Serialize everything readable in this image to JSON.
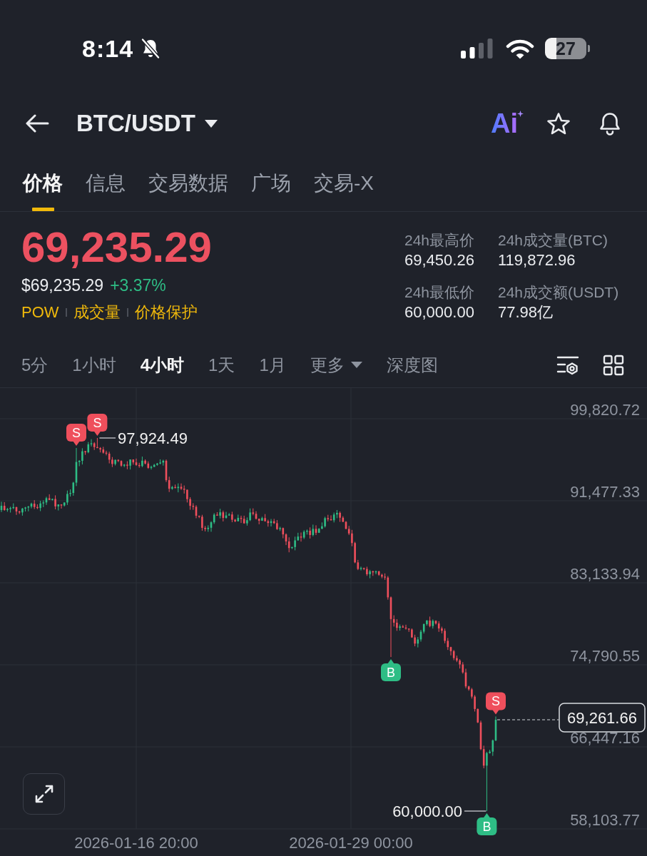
{
  "status_bar": {
    "time": "8:14",
    "battery": "27"
  },
  "header": {
    "pair": "BTC/USDT",
    "ai_label": "Ai"
  },
  "tabs": [
    {
      "label": "价格",
      "selected": true
    },
    {
      "label": "信息",
      "selected": false
    },
    {
      "label": "交易数据",
      "selected": false
    },
    {
      "label": "广场",
      "selected": false
    },
    {
      "label": "交易-X",
      "selected": false
    }
  ],
  "price": {
    "last": "69,235.29",
    "fiat": "$69,235.29",
    "change": "+3.37%",
    "tags": [
      "POW",
      "成交量",
      "价格保护"
    ]
  },
  "stats": [
    {
      "label": "24h最高价",
      "value": "69,450.26"
    },
    {
      "label": "24h成交量(BTC)",
      "value": "119,872.96"
    },
    {
      "label": "24h最低价",
      "value": "60,000.00"
    },
    {
      "label": "24h成交额(USDT)",
      "value": "77.98亿"
    }
  ],
  "intervals": [
    {
      "label": "5分",
      "selected": false,
      "kind": "option"
    },
    {
      "label": "1小时",
      "selected": false,
      "kind": "option"
    },
    {
      "label": "4小时",
      "selected": true,
      "kind": "option"
    },
    {
      "label": "1天",
      "selected": false,
      "kind": "option"
    },
    {
      "label": "1月",
      "selected": false,
      "kind": "option"
    },
    {
      "label": "更多",
      "selected": false,
      "kind": "menu"
    },
    {
      "label": "深度图",
      "selected": false,
      "kind": "option"
    }
  ],
  "chart": {
    "y_axis_labels": [
      "99,820.72",
      "91,477.33",
      "83,133.94",
      "74,790.55",
      "66,447.16",
      "58,103.77"
    ],
    "x_axis_labels": [
      "2026-01-16 20:00",
      "2026-01-29 00:00"
    ],
    "high_label": "97,924.49",
    "low_label": "60,000.00",
    "last_price_label": "69,261.66",
    "markers": [
      {
        "kind": "sell",
        "label": "S"
      },
      {
        "kind": "sell",
        "label": "S"
      },
      {
        "kind": "buy",
        "label": "B"
      },
      {
        "kind": "sell",
        "label": "S"
      },
      {
        "kind": "buy",
        "label": "B"
      }
    ]
  }
}
